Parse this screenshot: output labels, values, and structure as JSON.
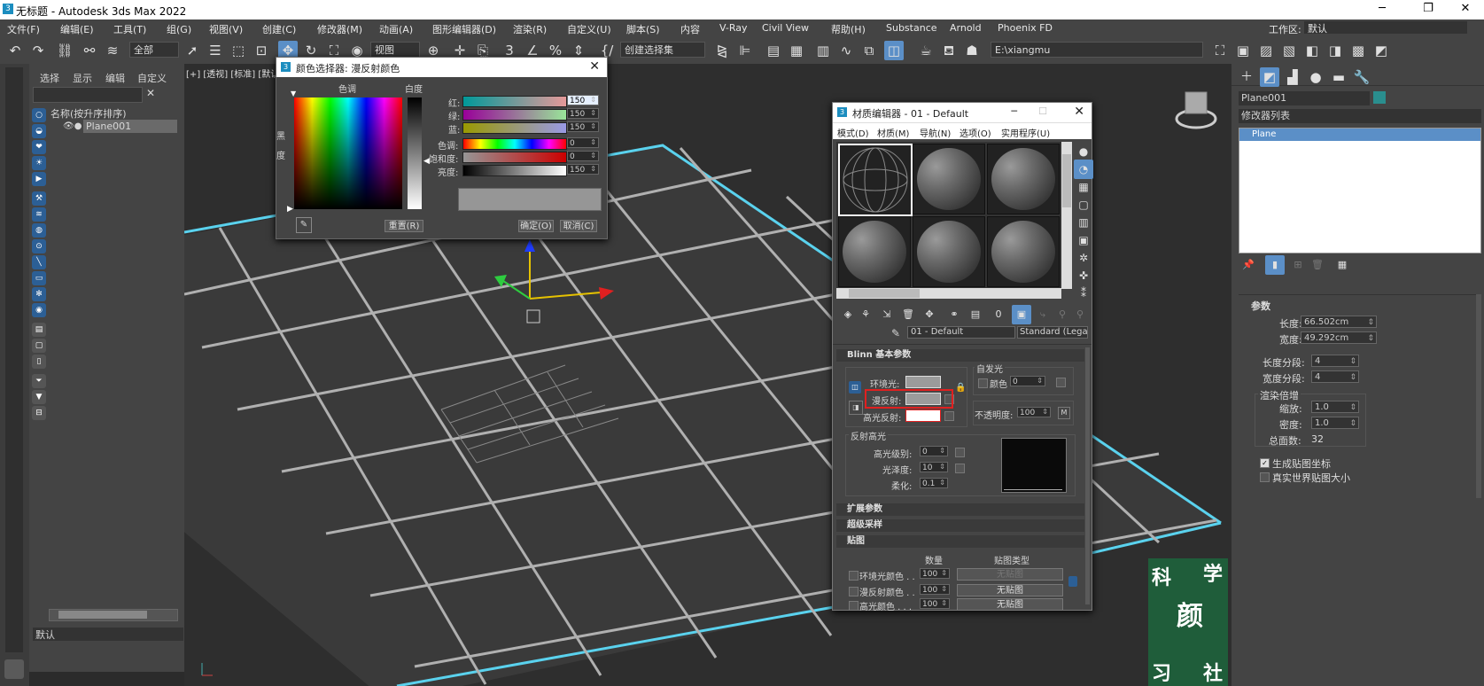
{
  "window": {
    "title": "无标题 - Autodesk 3ds Max 2022",
    "app_icon": "3",
    "controls": {
      "minimize": "─",
      "restore": "❐",
      "close": "✕"
    }
  },
  "menu": [
    "文件(F)",
    "编辑(E)",
    "工具(T)",
    "组(G)",
    "视图(V)",
    "创建(C)",
    "修改器(M)",
    "动画(A)",
    "图形编辑器(D)",
    "渲染(R)",
    "自定义(U)",
    "脚本(S)",
    "内容",
    "V-Ray",
    "Civil View",
    "帮助(H)",
    "Substance",
    "Arnold",
    "Phoenix FD"
  ],
  "workspace": {
    "label": "工作区:",
    "value": "默认"
  },
  "toolbar": {
    "selection_filter": "全部",
    "ref_coord": "视图",
    "named_sel": "创建选择集",
    "path": "E:\\xiangmu"
  },
  "scene_explorer": {
    "tabs": [
      "选择",
      "显示",
      "编辑",
      "自定义"
    ],
    "column_header": "名称(按升序排序)",
    "items": [
      "Plane001"
    ]
  },
  "viewport": {
    "label": "[+] [透视] [标准] [默认"
  },
  "status": {
    "layer": "默认"
  },
  "color_dialog": {
    "title": "颜色选择器: 漫反射颜色",
    "hue_label": "色调",
    "white_label": "白度",
    "black_label": "黑",
    "degree_label": "度",
    "channels": [
      {
        "label": "红:",
        "value": "150"
      },
      {
        "label": "绿:",
        "value": "150"
      },
      {
        "label": "蓝:",
        "value": "150"
      }
    ],
    "hsv": [
      {
        "label": "色调:",
        "value": "0"
      },
      {
        "label": "饱和度:",
        "value": "0"
      },
      {
        "label": "亮度:",
        "value": "150"
      }
    ],
    "reset": "重置(R)",
    "ok": "确定(O)",
    "cancel": "取消(C)"
  },
  "material_editor": {
    "title": "材质编辑器 - 01 - Default",
    "menus": [
      "模式(D)",
      "材质(M)",
      "导航(N)",
      "选项(O)",
      "实用程序(U)"
    ],
    "material_name": "01 - Default",
    "material_type": "Standard (Legac",
    "blinn_title": "Blinn 基本参数",
    "self_illum": "自发光",
    "color_label": "颜色",
    "color_value": "0",
    "ambient": "环境光:",
    "diffuse": "漫反射:",
    "specular": "高光反射:",
    "opacity_label": "不透明度:",
    "opacity_value": "100",
    "map_btn": "M",
    "spec_hl": "反射高光",
    "spec_level_label": "高光级别:",
    "spec_level": "0",
    "gloss_label": "光泽度:",
    "gloss": "10",
    "soften_label": "柔化:",
    "soften": "0.1",
    "rollouts": [
      "扩展参数",
      "超级采样",
      "贴图"
    ],
    "maps_cols": [
      "数量",
      "贴图类型"
    ],
    "maps": [
      {
        "name": "环境光颜色 . .",
        "amt": "100",
        "map": "无贴图"
      },
      {
        "name": "漫反射颜色 . .",
        "amt": "100",
        "map": "无贴图"
      },
      {
        "name": "高光颜色 . . .",
        "amt": "100",
        "map": "无贴图"
      }
    ]
  },
  "command_panel": {
    "object_name": "Plane001",
    "modifier_list": "修改器列表",
    "stack_item": "Plane",
    "params_title": "参数",
    "length_label": "长度:",
    "length": "66.502cm",
    "width_label": "宽度:",
    "width": "49.292cm",
    "lseg_label": "长度分段:",
    "lseg": "4",
    "wseg_label": "宽度分段:",
    "wseg": "4",
    "render_mult": "渲染倍增",
    "scale_label": "缩放:",
    "scale": "1.0",
    "density_label": "密度:",
    "density": "1.0",
    "faces_label": "总面数:",
    "faces": "32",
    "gen_uv": "生成贴图坐标",
    "real_world": "真实世界贴图大小"
  },
  "watermark": {
    "chars": [
      "科",
      "学",
      "颜",
      "习",
      "社"
    ]
  },
  "colors": {
    "accent": "#2c5f95",
    "selection_edge": "#5ad2ee",
    "red_box": "#e02020"
  }
}
